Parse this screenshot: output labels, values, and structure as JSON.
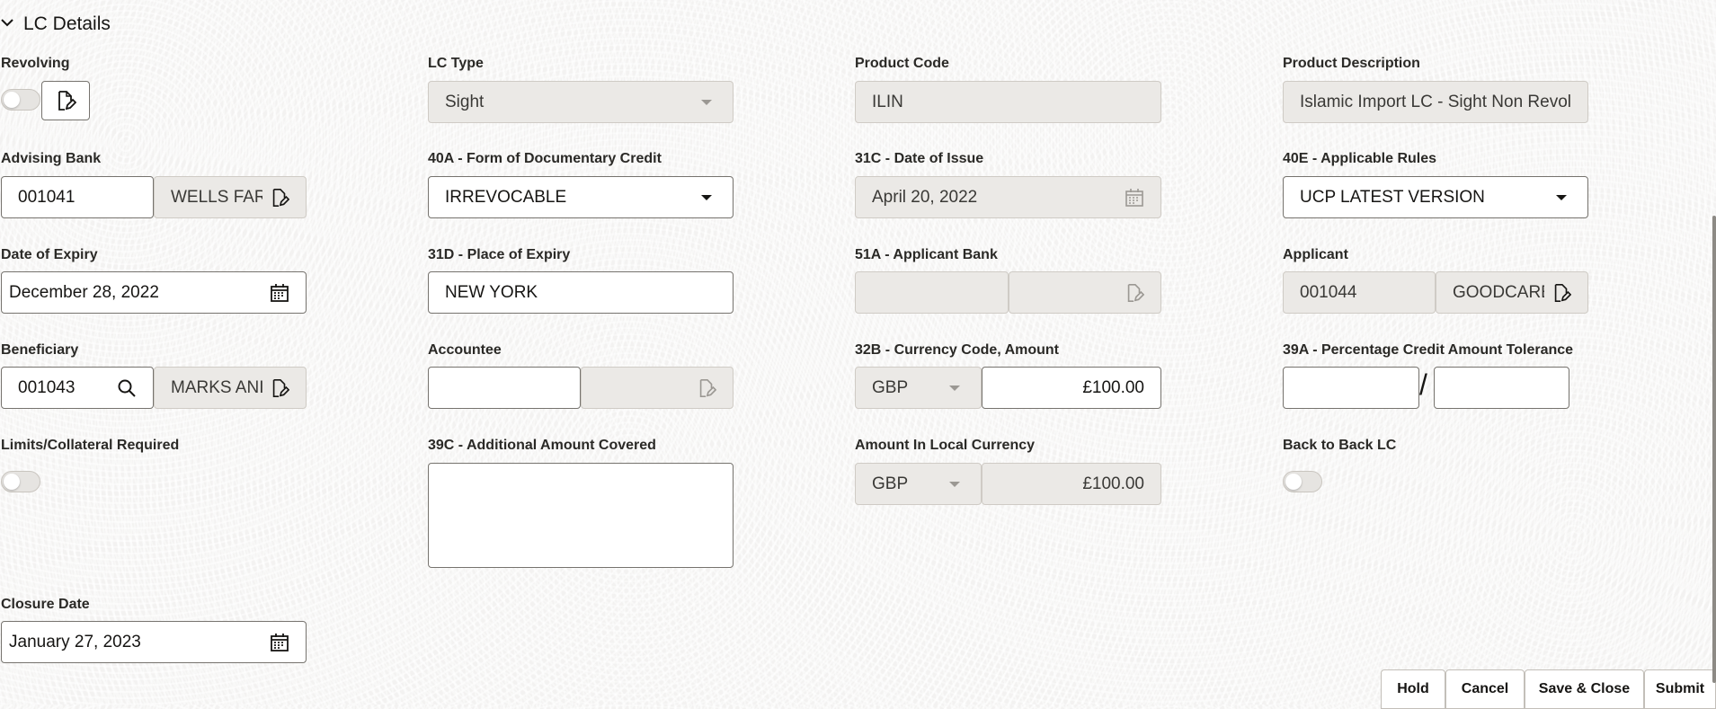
{
  "section": {
    "title": "LC Details"
  },
  "fields": {
    "revolving": {
      "label": "Revolving"
    },
    "lc_type": {
      "label": "LC Type",
      "value": "Sight"
    },
    "product_code": {
      "label": "Product Code",
      "value": "ILIN"
    },
    "product_description": {
      "label": "Product Description",
      "value": "Islamic Import LC - Sight Non Revol"
    },
    "advising_bank": {
      "label": "Advising Bank",
      "code": "001041",
      "name": "WELLS FAR"
    },
    "form_of_credit": {
      "label": "40A - Form of Documentary Credit",
      "value": "IRREVOCABLE"
    },
    "date_of_issue": {
      "label": "31C - Date of Issue",
      "value": "April 20, 2022"
    },
    "applicable_rules": {
      "label": "40E - Applicable Rules",
      "value": "UCP LATEST VERSION"
    },
    "date_of_expiry": {
      "label": "Date of Expiry",
      "value": "December 28, 2022"
    },
    "place_of_expiry": {
      "label": "31D - Place of Expiry",
      "value": "NEW YORK"
    },
    "applicant_bank": {
      "label": "51A - Applicant Bank",
      "code": "",
      "name": ""
    },
    "applicant": {
      "label": "Applicant",
      "code": "001044",
      "name": "GOODCARE"
    },
    "beneficiary": {
      "label": "Beneficiary",
      "code": "001043",
      "name": "MARKS ANI"
    },
    "accountee": {
      "label": "Accountee",
      "code": "",
      "name": ""
    },
    "currency_amount": {
      "label": "32B - Currency Code, Amount",
      "currency": "GBP",
      "amount": "£100.00"
    },
    "tolerance": {
      "label": "39A - Percentage Credit Amount Tolerance",
      "plus": "",
      "separator": "/",
      "minus": ""
    },
    "limits_collateral": {
      "label": "Limits/Collateral Required"
    },
    "additional_amount": {
      "label": "39C - Additional Amount Covered",
      "value": ""
    },
    "local_currency": {
      "label": "Amount In Local Currency",
      "currency": "GBP",
      "amount": "£100.00"
    },
    "back_to_back": {
      "label": "Back to Back LC"
    },
    "closure_date": {
      "label": "Closure Date",
      "value": "January 27, 2023"
    }
  },
  "buttons": {
    "hold": "Hold",
    "cancel": "Cancel",
    "save_close": "Save & Close",
    "submit": "Submit"
  },
  "icons": {
    "chevron": "chevron-down-icon",
    "calendar": "calendar-icon",
    "search": "search-icon",
    "edit_doc": "edit-document-icon",
    "dropdown": "caret-down-icon"
  }
}
